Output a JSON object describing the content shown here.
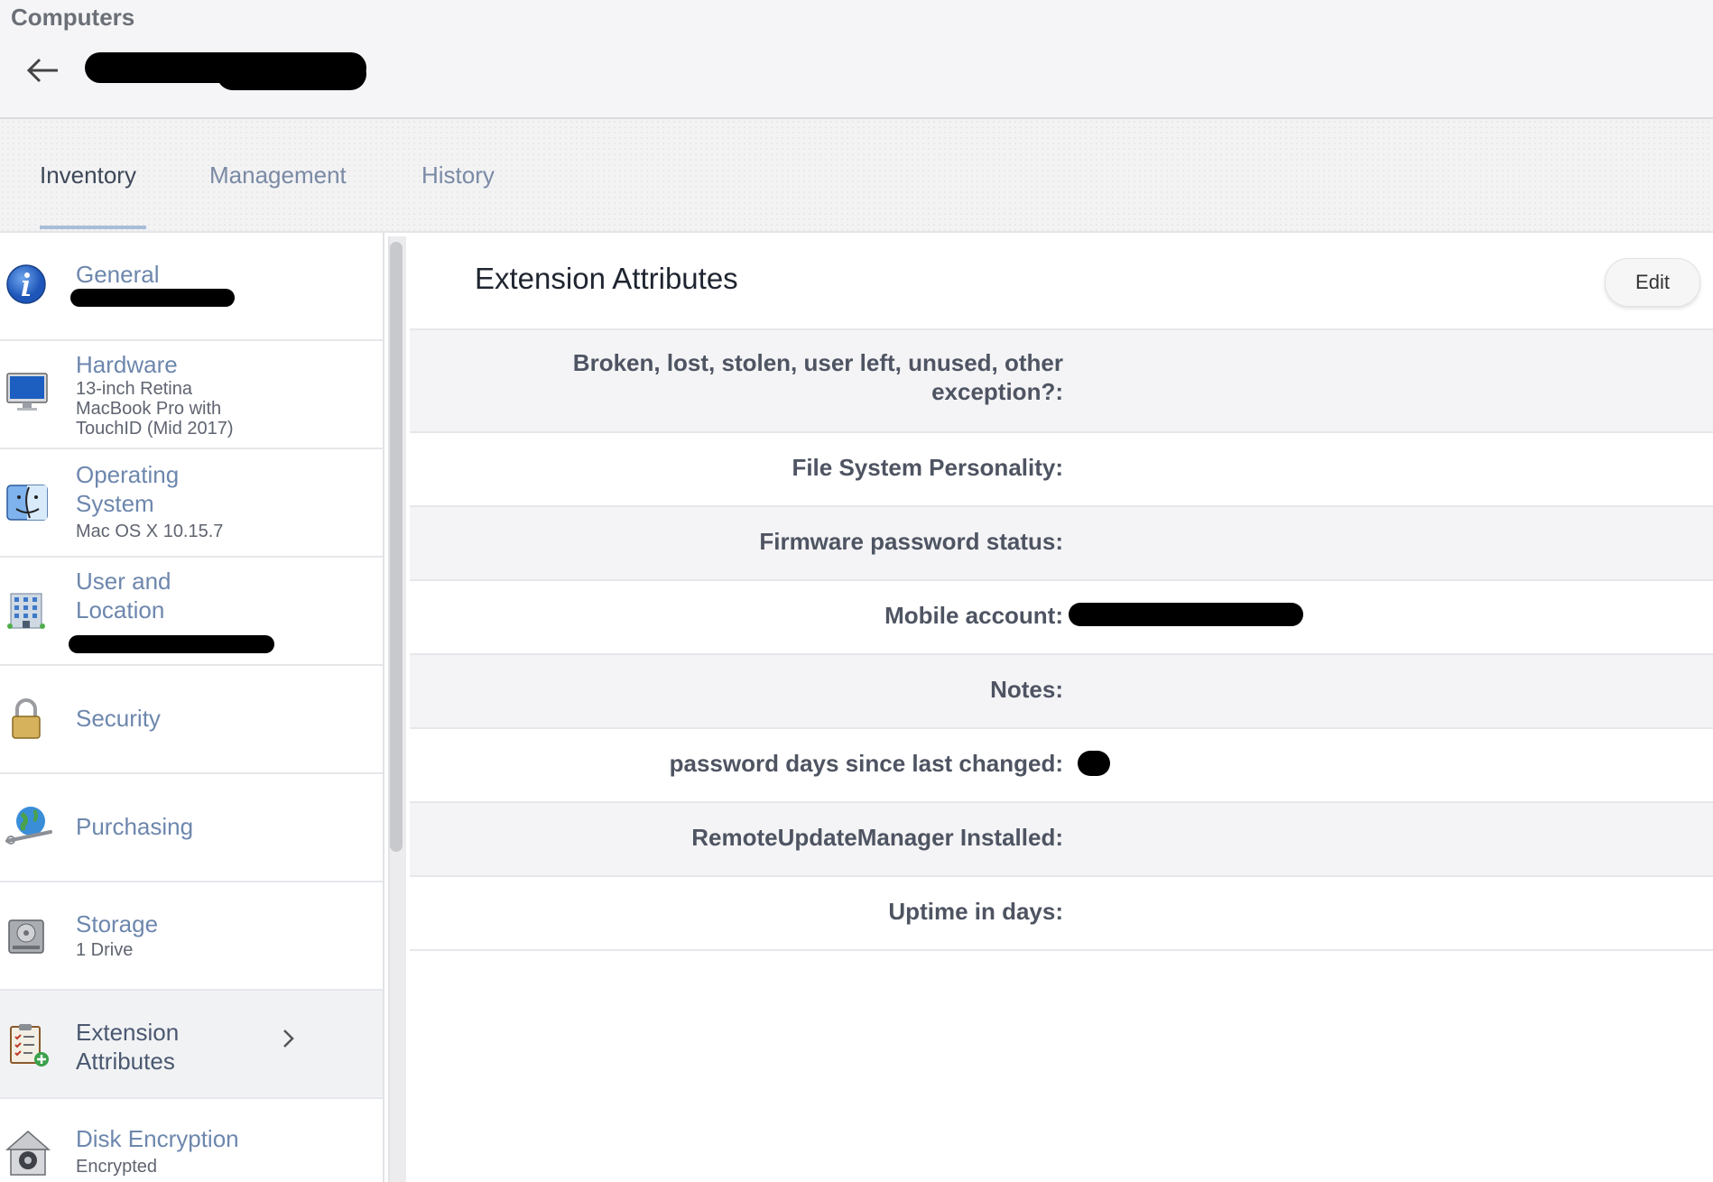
{
  "header": {
    "breadcrumb": "Computers",
    "back_icon": "arrow-left-icon"
  },
  "tabs": [
    {
      "label": "Inventory",
      "active": true
    },
    {
      "label": "Management",
      "active": false
    },
    {
      "label": "History",
      "active": false
    }
  ],
  "sidebar": {
    "items": [
      {
        "label": "General",
        "subtitle": "",
        "icon": "info-icon",
        "selected": false
      },
      {
        "label": "Hardware",
        "subtitle": "13-inch Retina MacBook Pro with TouchID (Mid 2017)",
        "subtitle_lines": [
          "13-inch Retina",
          "MacBook Pro with",
          "TouchID (Mid 2017)"
        ],
        "icon": "monitor-icon",
        "selected": false
      },
      {
        "label": "Operating System",
        "label_lines": [
          "Operating",
          "System"
        ],
        "subtitle": "Mac OS X 10.15.7",
        "icon": "finder-icon",
        "selected": false
      },
      {
        "label": "User and Location",
        "label_lines": [
          "User and",
          "Location"
        ],
        "subtitle": "",
        "icon": "building-icon",
        "selected": false
      },
      {
        "label": "Security",
        "subtitle": "",
        "icon": "padlock-icon",
        "selected": false
      },
      {
        "label": "Purchasing",
        "subtitle": "",
        "icon": "globe-wrench-icon",
        "selected": false
      },
      {
        "label": "Storage",
        "subtitle": "1 Drive",
        "icon": "hard-drive-icon",
        "selected": false
      },
      {
        "label": "Extension Attributes",
        "label_lines": [
          "Extension",
          "Attributes"
        ],
        "subtitle": "",
        "icon": "clipboard-add-icon",
        "selected": true
      },
      {
        "label": "Disk Encryption",
        "subtitle": "Encrypted",
        "icon": "filevault-icon",
        "selected": false
      }
    ]
  },
  "panel": {
    "title": "Extension Attributes",
    "edit_label": "Edit",
    "attributes": [
      {
        "label": "Broken, lost, stolen, user left, unused, other exception?:",
        "label_lines": [
          "Broken, lost, stolen, user left, unused, other",
          "exception?:"
        ],
        "value": ""
      },
      {
        "label": "File System Personality:",
        "value": ""
      },
      {
        "label": "Firmware password status:",
        "value": ""
      },
      {
        "label": "Mobile account:",
        "value": ""
      },
      {
        "label": "Notes:",
        "value": ""
      },
      {
        "label": "password days since last changed:",
        "value": ""
      },
      {
        "label": "RemoteUpdateManager Installed:",
        "value": ""
      },
      {
        "label": "Uptime in days:",
        "value": ""
      }
    ]
  },
  "colors": {
    "link": "#6d87ad",
    "tab_underline": "#a8bdd8",
    "row_shade": "#f4f4f6"
  }
}
